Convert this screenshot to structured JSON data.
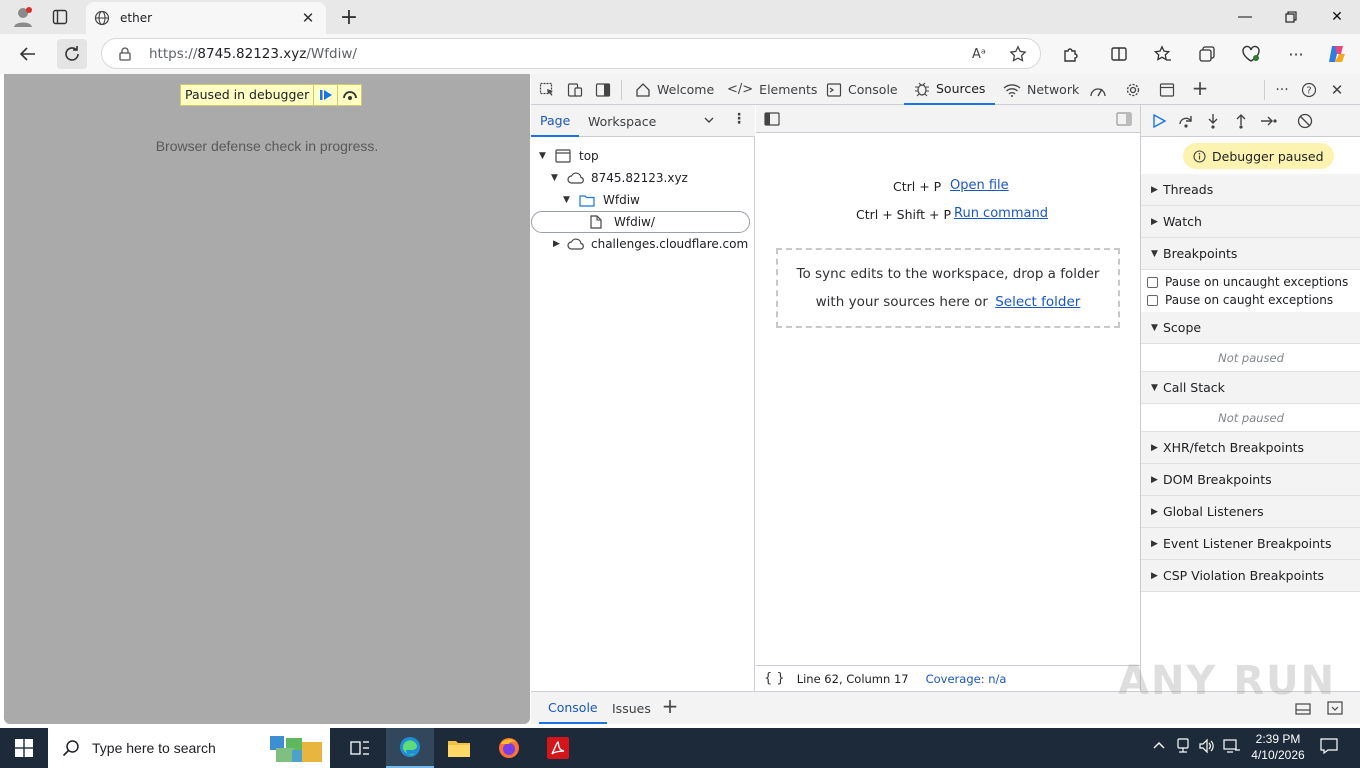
{
  "browser": {
    "tab_title": "ether",
    "url_prefix": "https://",
    "url_host": "8745.82123.xyz",
    "url_path": "/Wfdiw/",
    "read_aloud_label": "Aᵃ"
  },
  "page": {
    "paused_label": "Paused in debugger",
    "body_text": "Browser defense check in progress."
  },
  "devtools": {
    "tabs": [
      "Welcome",
      "Elements",
      "Console",
      "Sources",
      "Network"
    ],
    "active_tab": "Sources",
    "navigator": {
      "tabs": [
        "Page",
        "Workspace"
      ],
      "tree": [
        {
          "label": "top",
          "type": "frame",
          "depth": 0,
          "expanded": true
        },
        {
          "label": "8745.82123.xyz",
          "type": "cloud",
          "depth": 1,
          "expanded": true
        },
        {
          "label": "Wfdiw",
          "type": "folder",
          "depth": 2,
          "expanded": true
        },
        {
          "label": "Wfdiw/",
          "type": "file",
          "depth": 3,
          "selected": true
        },
        {
          "label": "challenges.cloudflare.com",
          "type": "cloud",
          "depth": 1,
          "expanded": false
        }
      ]
    },
    "editor": {
      "shortcut1_keys": "Ctrl + P",
      "shortcut1_link": "Open file",
      "shortcut2_keys": "Ctrl + Shift + P",
      "shortcut2_link": "Run command",
      "drop_line1": "To sync edits to the workspace, drop a folder",
      "drop_line2": "with your sources here or",
      "drop_link": "Select folder",
      "status_braces": "{ }",
      "status_position": "Line 62, Column 17",
      "status_coverage": "Coverage: n/a"
    },
    "debugger": {
      "banner": "Debugger paused",
      "sections": [
        {
          "label": "Threads",
          "expanded": false
        },
        {
          "label": "Watch",
          "expanded": false
        },
        {
          "label": "Breakpoints",
          "expanded": true
        },
        {
          "label": "Scope",
          "expanded": true
        },
        {
          "label": "Call Stack",
          "expanded": true
        },
        {
          "label": "XHR/fetch Breakpoints",
          "expanded": false
        },
        {
          "label": "DOM Breakpoints",
          "expanded": false
        },
        {
          "label": "Global Listeners",
          "expanded": false
        },
        {
          "label": "Event Listener Breakpoints",
          "expanded": false
        },
        {
          "label": "CSP Violation Breakpoints",
          "expanded": false
        }
      ],
      "breakpoint_options": [
        "Pause on uncaught exceptions",
        "Pause on caught exceptions"
      ],
      "not_paused": "Not paused"
    },
    "drawer_tabs": [
      "Console",
      "Issues"
    ]
  },
  "watermark": "ANY RUN",
  "taskbar": {
    "search_placeholder": "Type here to search",
    "time": "2:39 PM",
    "date": "4/10/2026"
  },
  "colors": {
    "accent": "#1a73e8",
    "page_bg": "#aaaaaa",
    "paused_bg": "#ffffc4",
    "banner_bg": "#fdf3b1",
    "taskbar_bg": "#1c2a3a"
  }
}
